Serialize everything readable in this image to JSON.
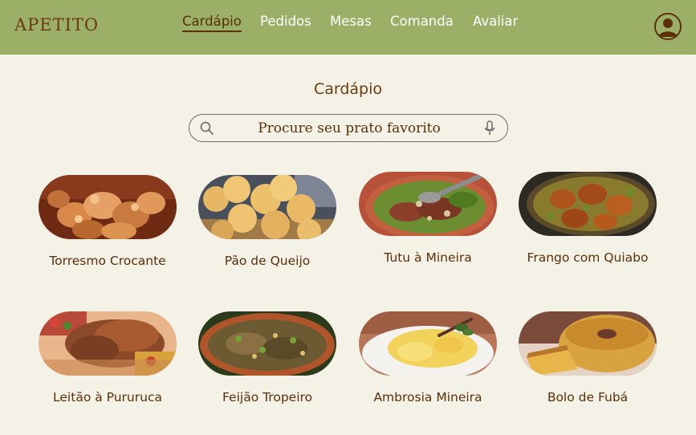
{
  "header": {
    "logo": "APETITO",
    "nav": [
      {
        "label": "Cardápio",
        "active": true
      },
      {
        "label": "Pedidos",
        "active": false
      },
      {
        "label": "Mesas",
        "active": false
      },
      {
        "label": "Comanda",
        "active": false
      },
      {
        "label": "Avaliar",
        "active": false
      }
    ],
    "avatar_icon": "user-avatar-icon"
  },
  "main": {
    "title": "Cardápio",
    "search": {
      "placeholder": "Procure seu prato favorito",
      "value": "",
      "left_icon": "search-icon",
      "right_icon": "microphone-icon"
    },
    "dishes": [
      {
        "name": "Torresmo Crocante"
      },
      {
        "name": "Pão de Queijo"
      },
      {
        "name": "Tutu à Mineira"
      },
      {
        "name": "Frango com Quiabo"
      },
      {
        "name": "Leitão à Pururuca"
      },
      {
        "name": "Feijão Tropeiro"
      },
      {
        "name": "Ambrosia Mineira"
      },
      {
        "name": "Bolo de Fubá"
      }
    ]
  },
  "colors": {
    "header_bg": "#9bb066",
    "page_bg": "#f4f2e7",
    "brand_brown": "#5a2f0a",
    "nav_text": "#ffffff"
  }
}
